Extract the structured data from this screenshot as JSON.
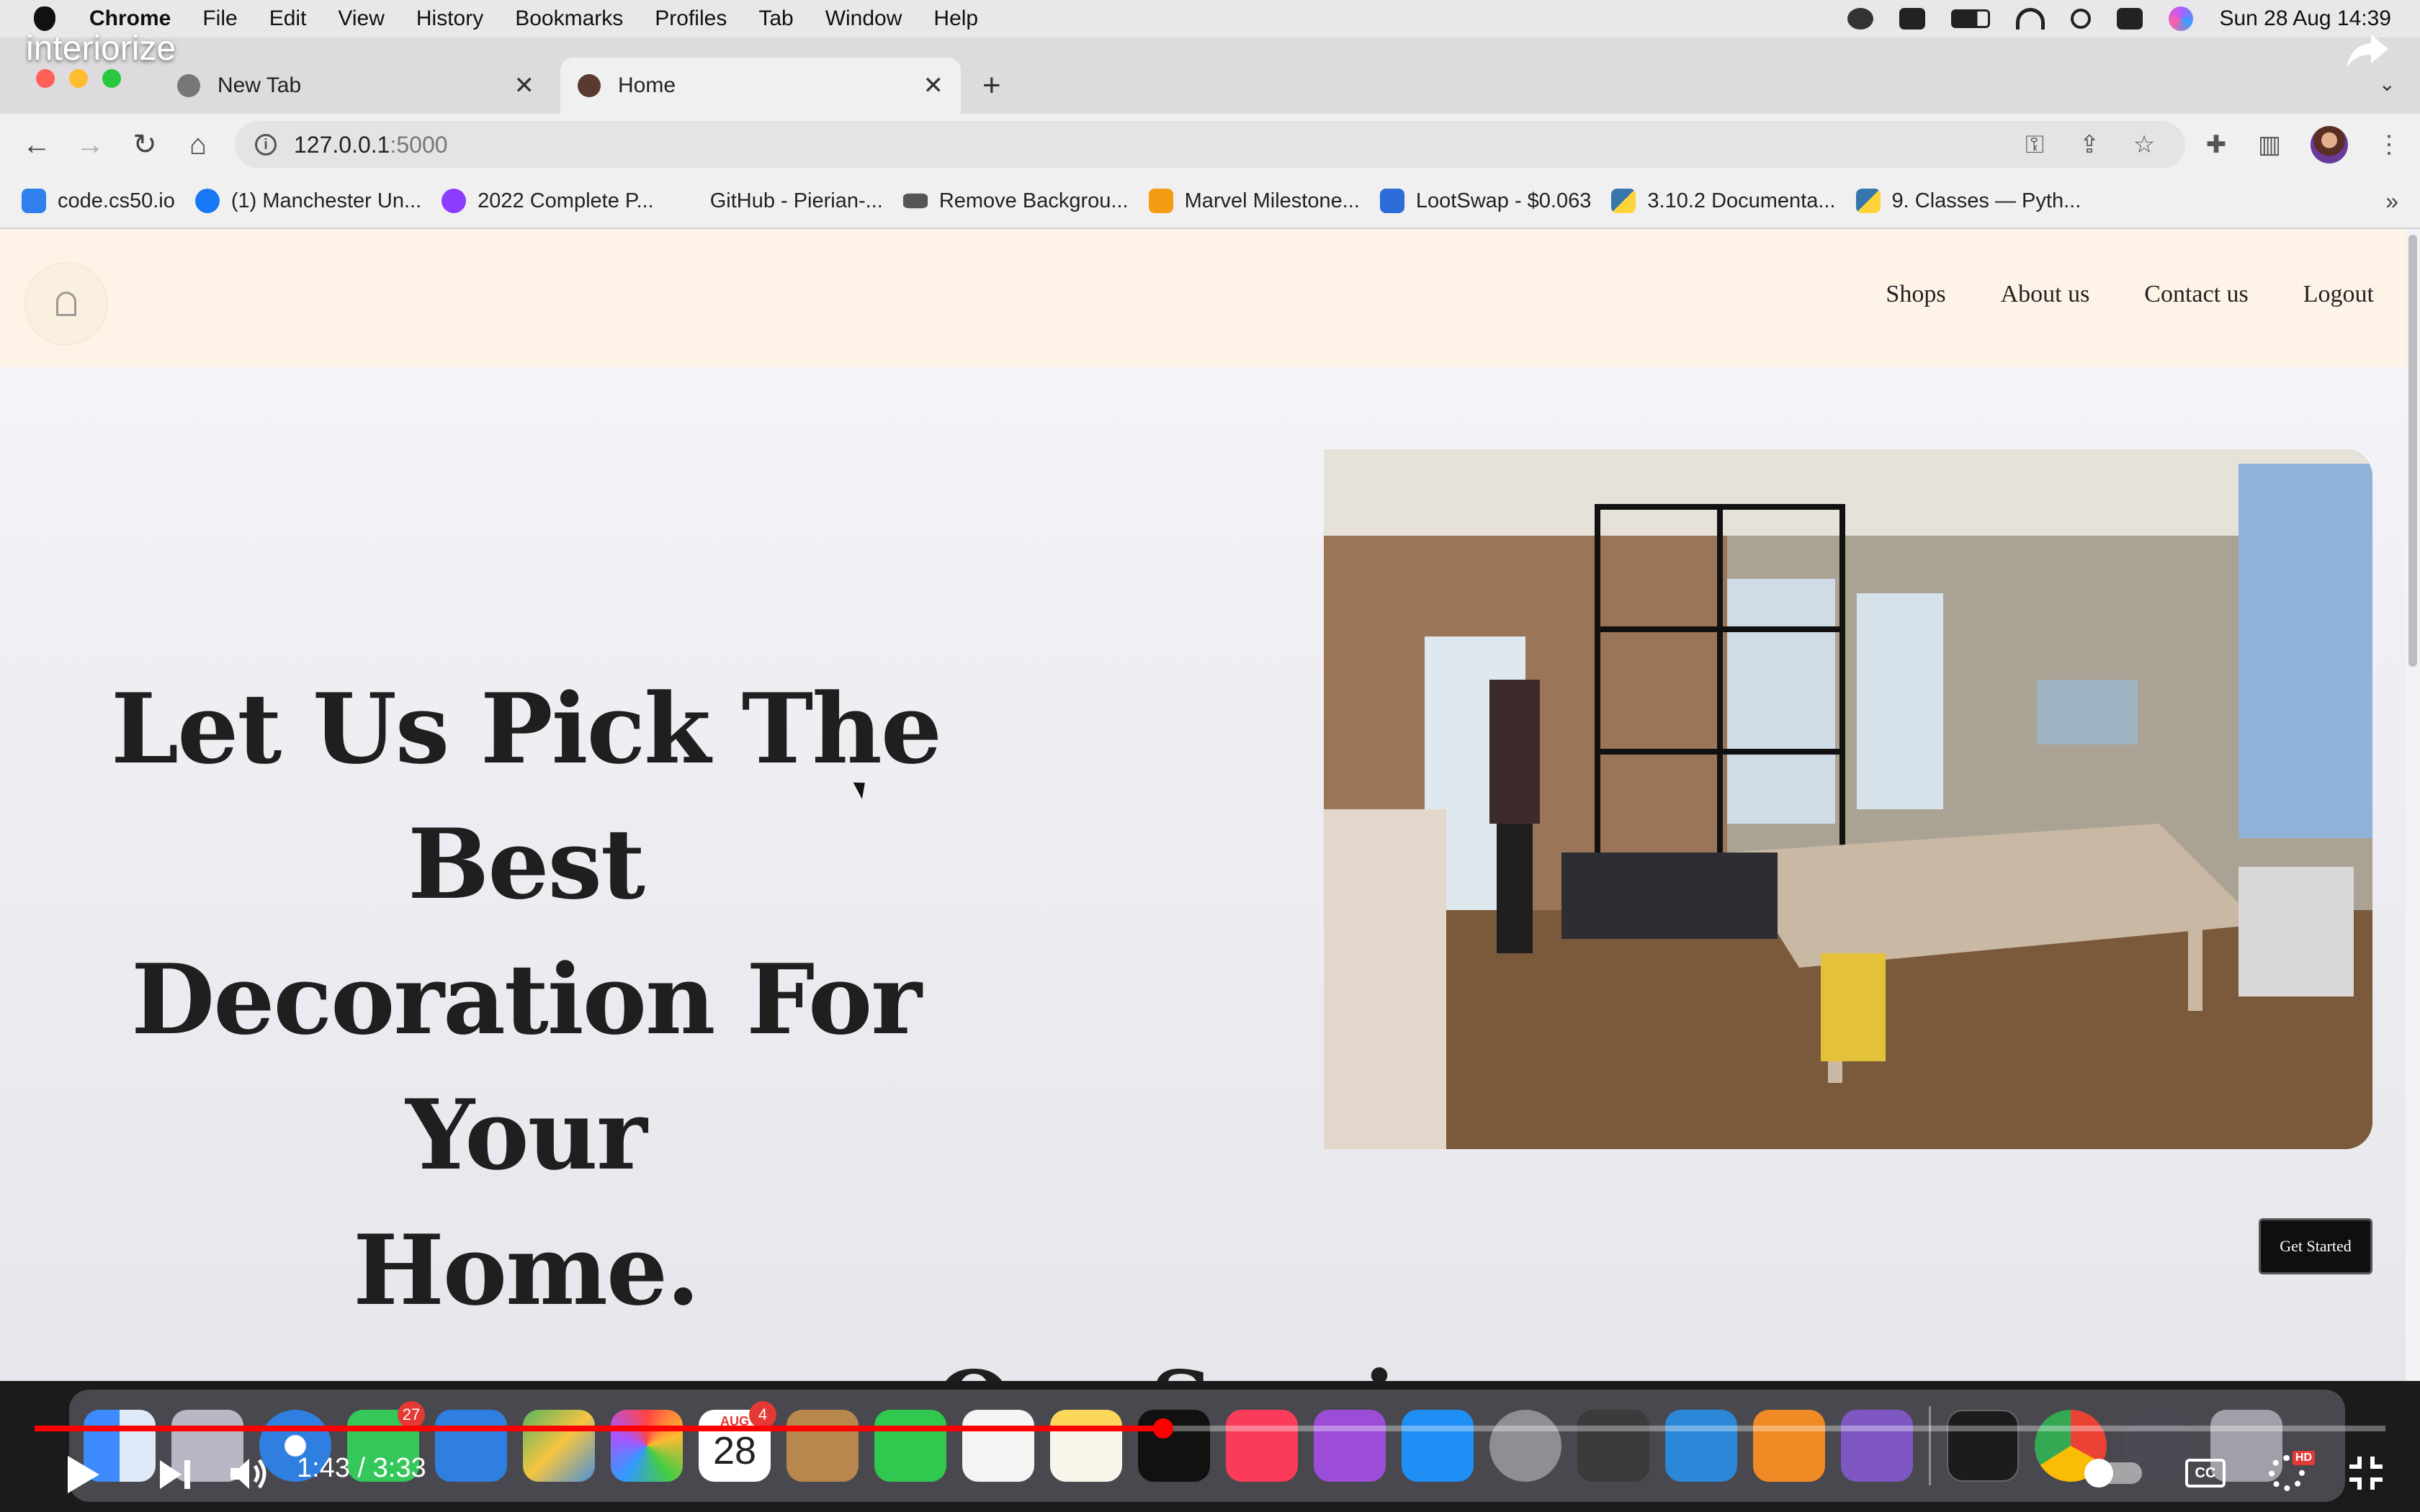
{
  "menubar": {
    "app": "Chrome",
    "items": [
      "File",
      "Edit",
      "View",
      "History",
      "Bookmarks",
      "Profiles",
      "Tab",
      "Window",
      "Help"
    ],
    "datetime": "Sun 28 Aug  14:39"
  },
  "video": {
    "title": "interiorize",
    "time": "1:43 / 3:33",
    "progress": 0.48,
    "hd_label": "HD",
    "cc_label": "CC"
  },
  "tabs": [
    {
      "title": "New Tab",
      "active": false
    },
    {
      "title": "Home",
      "active": true
    }
  ],
  "address": {
    "host": "127.0.0.1",
    "port": ":5000"
  },
  "bookmarks": [
    {
      "label": "code.cs50.io",
      "color": "#2f80ed"
    },
    {
      "label": "(1) Manchester Un...",
      "color": "#1877f2"
    },
    {
      "label": "2022 Complete P...",
      "color": "#8b3dff"
    },
    {
      "label": "GitHub - Pierian-...",
      "color": "transparent"
    },
    {
      "label": "Remove Backgrou...",
      "color": "#555555"
    },
    {
      "label": "Marvel Milestone...",
      "color": "#f39c12"
    },
    {
      "label": "LootSwap - $0.063",
      "color": "#2c6bd8"
    },
    {
      "label": "3.10.2 Documenta...",
      "color": "#3776ab"
    },
    {
      "label": "9. Classes — Pyth...",
      "color": "#3776ab"
    }
  ],
  "site": {
    "nav": [
      "Shops",
      "About us",
      "Contact us",
      "Logout"
    ],
    "hero_lines": [
      "Let Us Pick The Best",
      "Decoration For Your",
      "Home."
    ],
    "cta": "Get Started",
    "services_title": "Our Services"
  },
  "dock": {
    "messages_badge": "27",
    "calendar_month": "AUG",
    "calendar_day": "28",
    "calendar_badge": "4"
  },
  "colors": {
    "header_bg": "#fdf4e7",
    "cta_bg": "#0f0f0f",
    "progress": "#ff0000"
  }
}
